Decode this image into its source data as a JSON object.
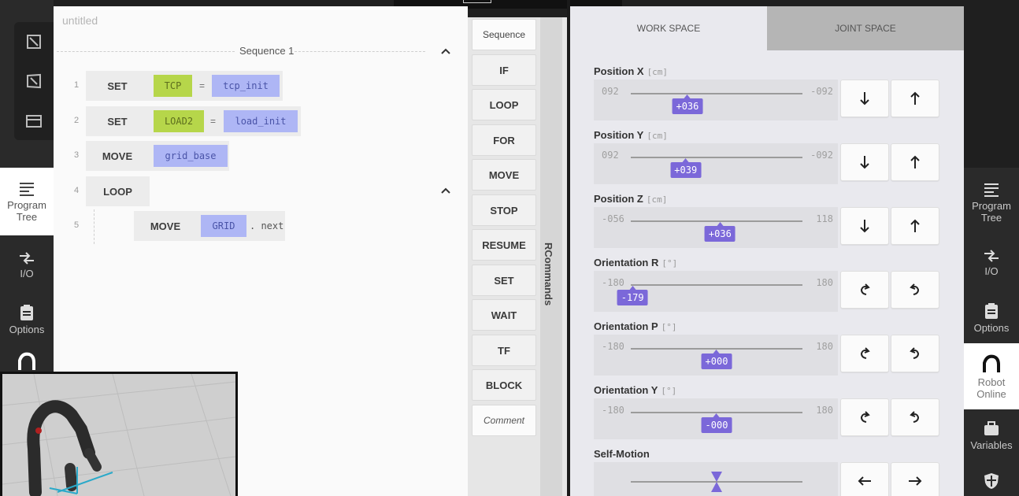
{
  "document": {
    "title": "untitled"
  },
  "sequence": {
    "title": "Sequence 1"
  },
  "program": {
    "lines": [
      {
        "n": "1",
        "cmd": "SET",
        "var": "TCP",
        "eq": "=",
        "value": "tcp_init"
      },
      {
        "n": "2",
        "cmd": "SET",
        "var": "LOAD2",
        "eq": "=",
        "value": "load_init"
      },
      {
        "n": "3",
        "cmd": "MOVE",
        "value": "grid_base"
      },
      {
        "n": "4",
        "cmd": "LOOP"
      },
      {
        "n": "5",
        "cmd": "MOVE",
        "var": "GRID",
        "suffix": ". next"
      }
    ]
  },
  "commands": {
    "items": [
      "Sequence",
      "IF",
      "LOOP",
      "FOR",
      "MOVE",
      "STOP",
      "RESUME",
      "SET",
      "WAIT",
      "TF",
      "BLOCK",
      "Comment"
    ],
    "panel_label": "RCommands"
  },
  "jog": {
    "tabs": [
      {
        "label": "WORK SPACE",
        "active": true
      },
      {
        "label": "JOINT SPACE",
        "active": false
      }
    ],
    "axes": [
      {
        "label": "Position X",
        "unit": "[cm]",
        "min": "092",
        "max": "-092",
        "value": "+036",
        "level": 0.33,
        "minus_icon": "arrow-down-icon",
        "plus_icon": "arrow-up-icon"
      },
      {
        "label": "Position Y",
        "unit": "[cm]",
        "min": "092",
        "max": "-092",
        "value": "+039",
        "level": 0.32,
        "minus_icon": "arrow-down-icon",
        "plus_icon": "arrow-up-icon"
      },
      {
        "label": "Position Z",
        "unit": "[cm]",
        "min": "-056",
        "max": "118",
        "value": "+036",
        "level": 0.52,
        "minus_icon": "arrow-down-icon",
        "plus_icon": "arrow-up-icon"
      },
      {
        "label": "Orientation R",
        "unit": "[°]",
        "min": "-180",
        "max": "180",
        "value": "-179",
        "level": 0.01,
        "minus_icon": "rotate-cw-icon",
        "plus_icon": "rotate-ccw-icon"
      },
      {
        "label": "Orientation P",
        "unit": "[°]",
        "min": "-180",
        "max": "180",
        "value": "+000",
        "level": 0.5,
        "minus_icon": "rotate-cw-icon",
        "plus_icon": "rotate-ccw-icon"
      },
      {
        "label": "Orientation Y",
        "unit": "[°]",
        "min": "-180",
        "max": "180",
        "value": "-000",
        "level": 0.5,
        "minus_icon": "rotate-cw-icon",
        "plus_icon": "rotate-ccw-icon"
      }
    ],
    "self_motion": {
      "label": "Self-Motion",
      "level": 0.5,
      "minus_icon": "arrow-left-icon",
      "plus_icon": "arrow-right-icon"
    }
  },
  "left_nav": [
    {
      "label": "Program Tree",
      "icon": "program-tree-icon",
      "active": true
    },
    {
      "label": "I/O",
      "icon": "io-icon",
      "active": false
    },
    {
      "label": "Options",
      "icon": "options-icon",
      "active": false
    }
  ],
  "right_nav": [
    {
      "label": "Program Tree",
      "icon": "program-tree-icon",
      "active": false
    },
    {
      "label": "I/O",
      "icon": "io-icon",
      "active": false
    },
    {
      "label": "Options",
      "icon": "options-icon",
      "active": false
    },
    {
      "label": "Robot Online",
      "icon": "robot-arm-icon",
      "active": true
    },
    {
      "label": "Variables",
      "icon": "variables-icon",
      "active": false
    }
  ],
  "colors": {
    "accent": "#7b68d9",
    "variable_chip": "#b6d64a",
    "value_chip": "#aeb6f5"
  }
}
